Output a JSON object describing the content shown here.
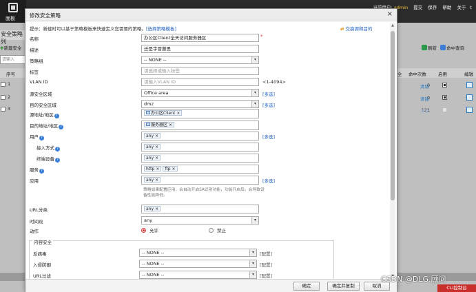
{
  "app": {
    "logo_label": "面板",
    "topnav": {
      "current_user_label": "当前用户:",
      "user": "admin",
      "submit": "提交",
      "save": "保存",
      "help": "帮助",
      "about": "关于",
      "tail": "t"
    },
    "left": {
      "title": "安全策略列",
      "new_label": "新建安全",
      "search_placeholder": "请输入",
      "col_index": "序号",
      "rows": [
        "1",
        "2",
        "3"
      ]
    },
    "right": {
      "refresh": "刷新",
      "hit_query": "命中查询",
      "col_full": "全",
      "col_hits": "命中次数",
      "col_enabled": "启用",
      "col_edit": "编辑",
      "rows": [
        {
          "hits": "0",
          "clear": "清除",
          "enabled": true
        },
        {
          "hits": "0",
          "clear": "清除",
          "enabled": true
        },
        {
          "hits": "121",
          "clear": "清除",
          "enabled": false
        }
      ]
    },
    "console_button": "CLI控制台",
    "accent": "#c9302c"
  },
  "dialog": {
    "title": "修改安全策略",
    "tip": "提示：新建时可以基于策略模板来快速定义您需要的策略。",
    "tip_link": "[选择策略模板]",
    "swap_link": "交换源和目的",
    "fields": {
      "name": {
        "label": "名称",
        "value": "办公区Client全天访问服务器区"
      },
      "description": {
        "label": "描述",
        "value": "迁是字冒蒽思"
      },
      "policy_group": {
        "label": "策略组",
        "value": "-- NONE --"
      },
      "tag": {
        "label": "标签",
        "placeholder": "请选择或输入标签"
      },
      "vlan": {
        "label": "VLAN ID",
        "placeholder": "请输入VLAN ID",
        "range": "<1-4094>"
      },
      "src_zone": {
        "label": "源安全区域",
        "value": "Office area",
        "multi": "[多选]"
      },
      "dst_zone": {
        "label": "目的安全区域",
        "value": "dmz",
        "multi": "[多选]"
      },
      "src_addr": {
        "label": "源地址/地区",
        "tag": "办公区Client"
      },
      "dst_addr": {
        "label": "目的地址/地区",
        "tag": "服务器区"
      },
      "user": {
        "label": "用户",
        "tag": "any",
        "multi": "[多选]"
      },
      "access_mode": {
        "label": "接入方式",
        "tag": "any"
      },
      "terminal": {
        "label": "终端设备",
        "tag": "any"
      },
      "service": {
        "label": "服务",
        "tags": [
          "http",
          "ftp"
        ]
      },
      "application": {
        "label": "应用",
        "tag": "any",
        "multi": "[多选]",
        "hint": "策略如果配置应用，会自动开启SA识别功能，功能开启后，会导致设备性能降低。"
      },
      "url": {
        "label": "URL分类",
        "tag": "any"
      },
      "schedule": {
        "label": "时间段",
        "value": "any"
      },
      "action": {
        "label": "动作",
        "allow": "允许",
        "deny": "禁止",
        "selected": "allow"
      }
    },
    "content_security": {
      "legend": "内容安全",
      "antivirus": {
        "label": "反病毒",
        "value": "-- NONE --",
        "config": "[配置]"
      },
      "ips": {
        "label": "入侵防御",
        "value": "-- NONE --",
        "config": "[配置]"
      },
      "url_filter": {
        "label": "URL过滤",
        "value": "-- NONE --",
        "config": "[配置]"
      }
    },
    "buttons": {
      "ok": "确定",
      "ok_copy": "确定并复制",
      "cancel": "取消"
    }
  },
  "watermark": "CSDN @DLG.顾问"
}
